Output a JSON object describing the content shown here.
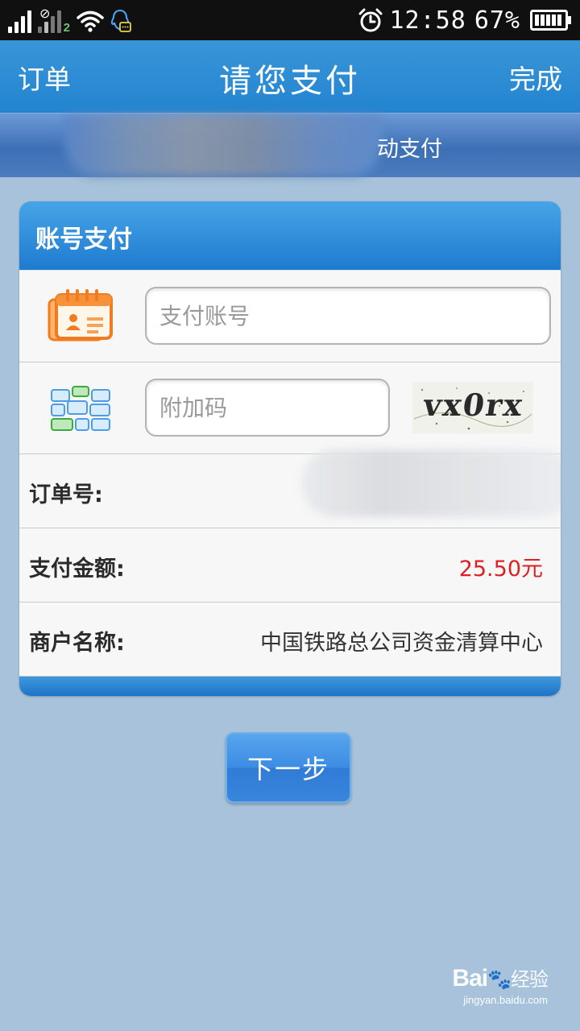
{
  "status_bar": {
    "time": "12:58",
    "battery_percent": "67%",
    "sim2_label": "2",
    "icons": [
      "signal-icon",
      "signal-2-icon",
      "wifi-icon",
      "qq-notification-icon",
      "alarm-icon",
      "battery-icon"
    ]
  },
  "nav": {
    "left_label": "订单",
    "title": "请您支付",
    "right_label": "完成"
  },
  "sub_tab": {
    "label": "动支付"
  },
  "card": {
    "title": "账号支付",
    "account_input": {
      "value": "",
      "placeholder": "支付账号"
    },
    "extra_code_input": {
      "value": "",
      "placeholder": "附加码"
    },
    "captcha_text": "vx0rx",
    "order_no_label": "订单号:",
    "amount_label": "支付金额:",
    "amount_value": "25.50元",
    "merchant_label": "商户名称:",
    "merchant_value": "中国铁路总公司资金清算中心"
  },
  "next_button": {
    "label": "下一步"
  },
  "watermark": {
    "logo": "Bai",
    "logo_suffix": "经验",
    "url": "jingyan.baidu.com"
  },
  "colors": {
    "nav_blue": "#2a8ad2",
    "background": "#a7c2da",
    "amount_red": "#e02020",
    "button_blue": "#3a8ae0",
    "card_header_blue": "#2b86d6"
  }
}
